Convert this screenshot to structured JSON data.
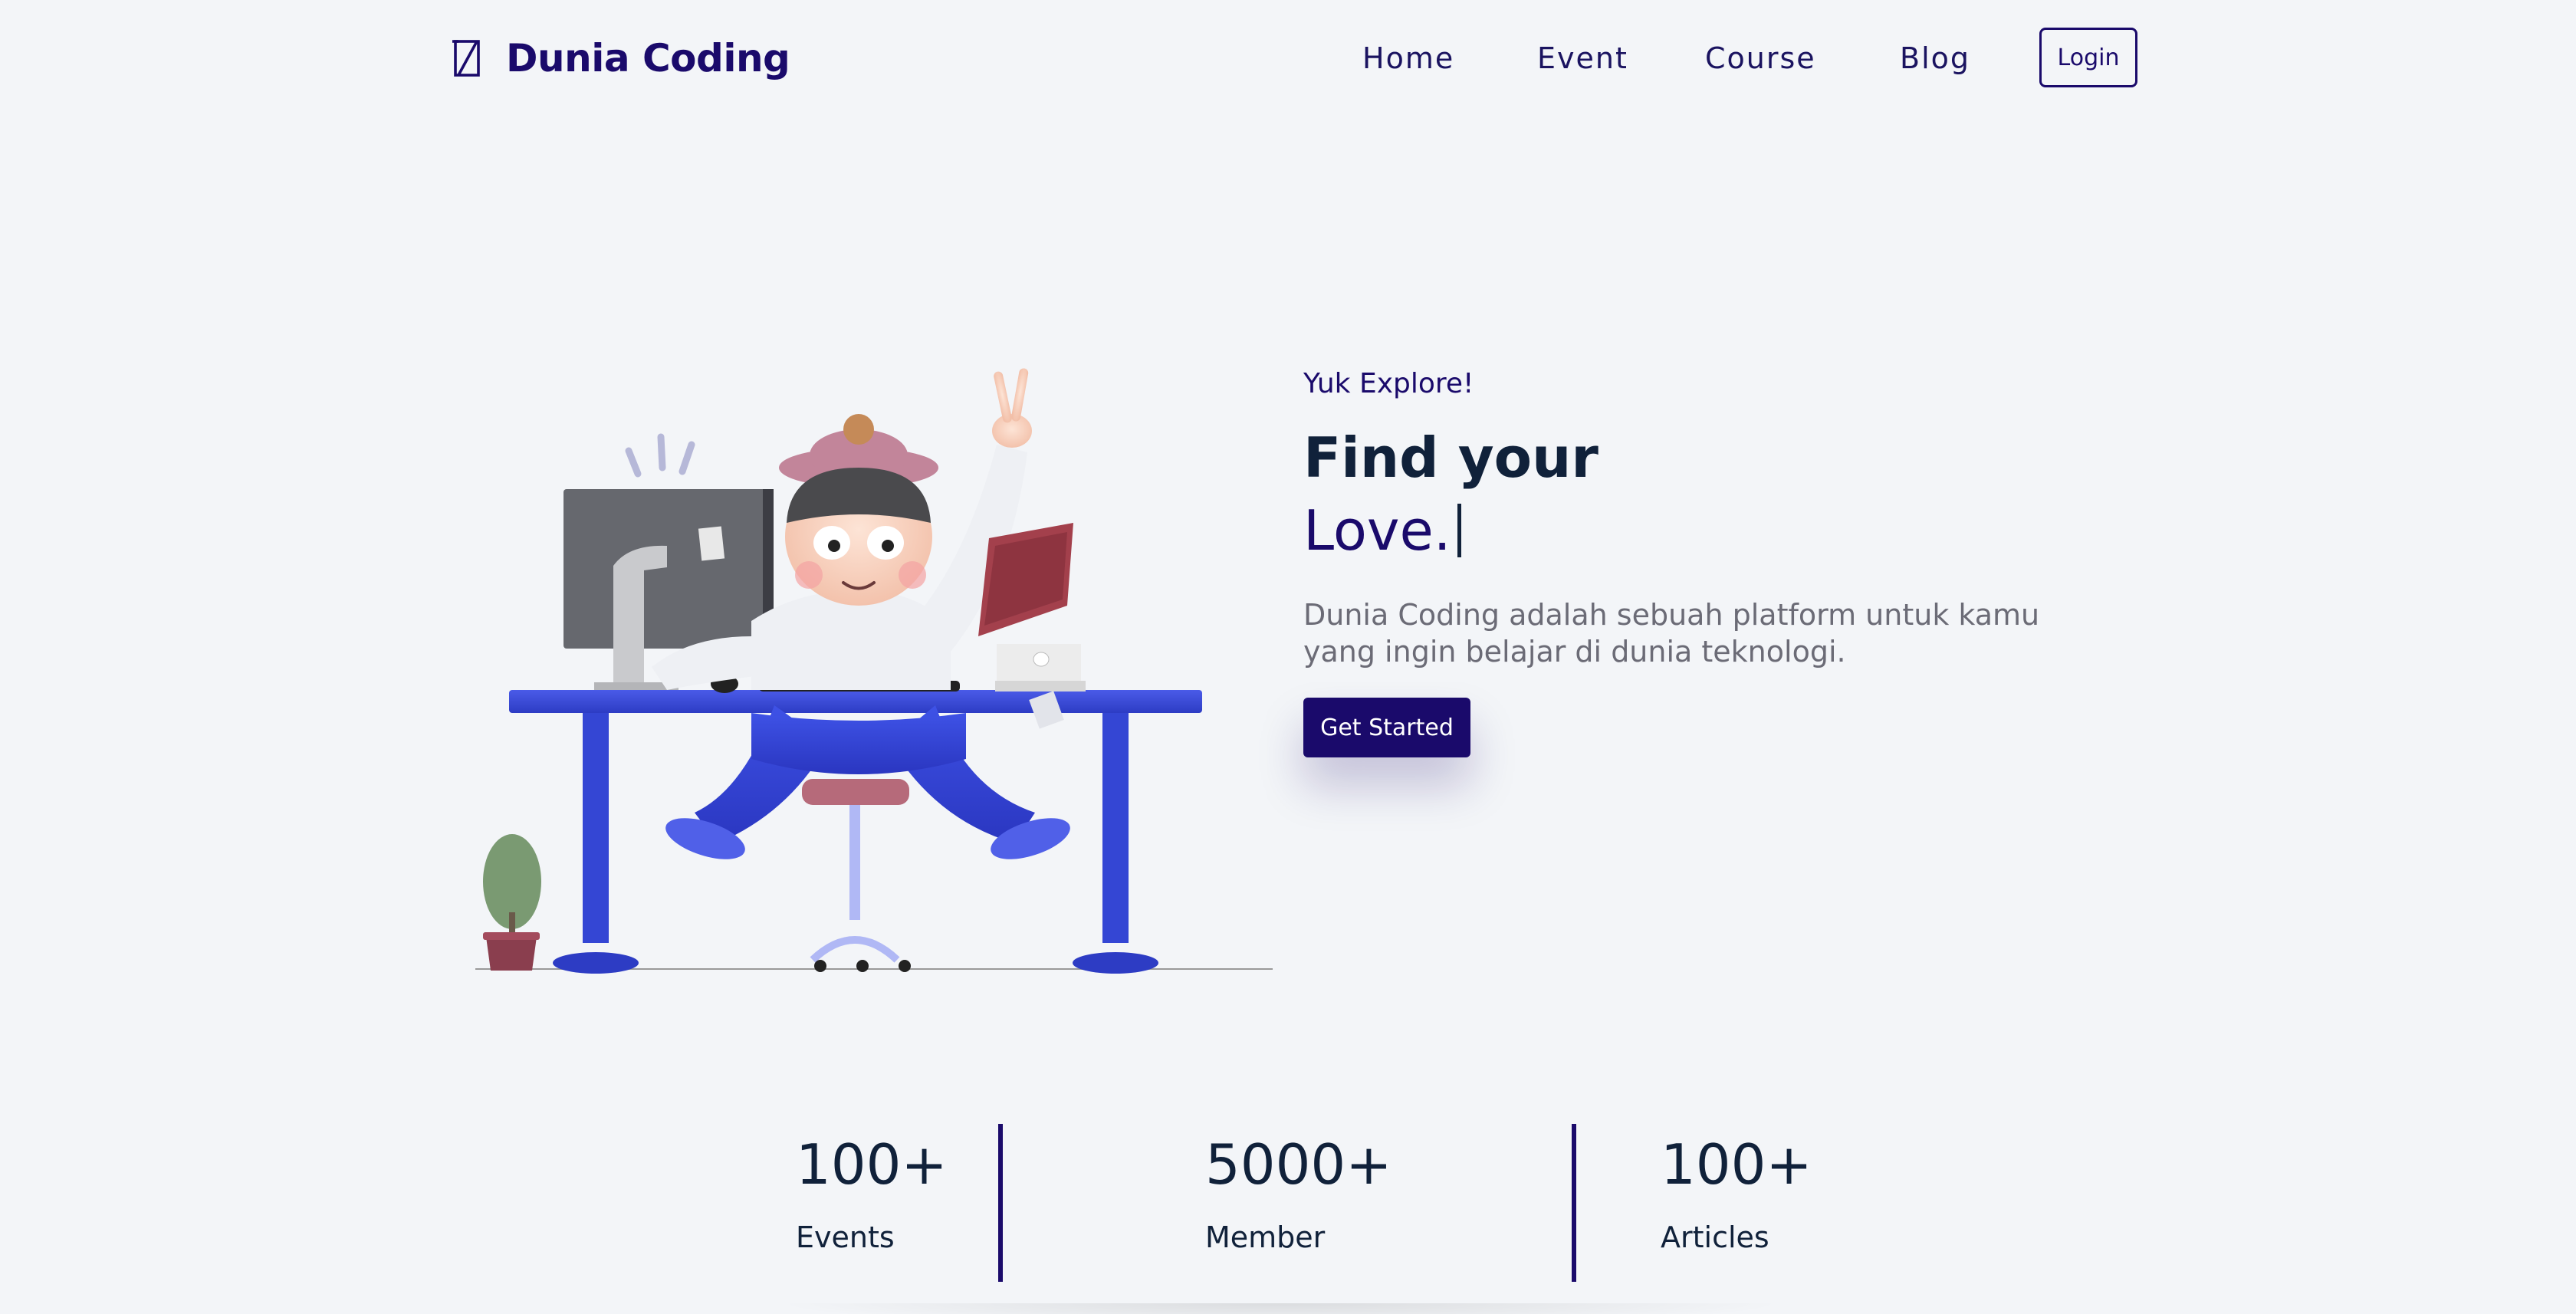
{
  "nav": {
    "brand_name": "Dunia Coding",
    "logo_icon": "slash-box-logo-icon",
    "links": [
      {
        "label": "Home"
      },
      {
        "label": "Event"
      },
      {
        "label": "Course"
      },
      {
        "label": "Blog"
      }
    ],
    "login_label": "Login"
  },
  "hero": {
    "eyebrow": "Yuk Explore!",
    "title_line1": "Find your",
    "title_line2": "Love.",
    "description": "Dunia Coding adalah sebuah platform untuk kamu yang ingin belajar di dunia teknologi.",
    "cta_label": "Get Started",
    "illustration": "person-at-desk-illustration"
  },
  "stats": [
    {
      "value": "100+",
      "label": "Events"
    },
    {
      "value": "5000+",
      "label": "Member"
    },
    {
      "value": "100+",
      "label": "Articles"
    }
  ],
  "colors": {
    "brand": "#1a0a6b",
    "heading": "#10213a",
    "muted": "#6b6b76",
    "background": "#f3f5f8",
    "desk": "#3d4fd6"
  }
}
